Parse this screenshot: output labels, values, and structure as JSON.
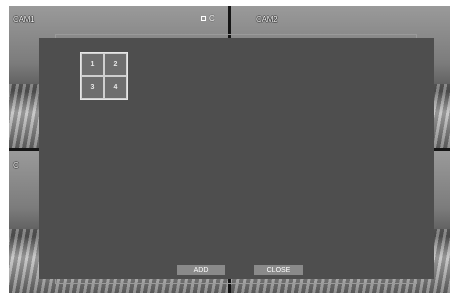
{
  "cameras": [
    {
      "label": "CAM1"
    },
    {
      "label": "CAM2"
    },
    {
      "label": "C"
    },
    {
      "label": ""
    }
  ],
  "status": {
    "text": "C"
  },
  "dialog": {
    "grid": [
      "1",
      "2",
      "3",
      "4"
    ],
    "add_label": "ADD",
    "close_label": "CLOSE"
  }
}
